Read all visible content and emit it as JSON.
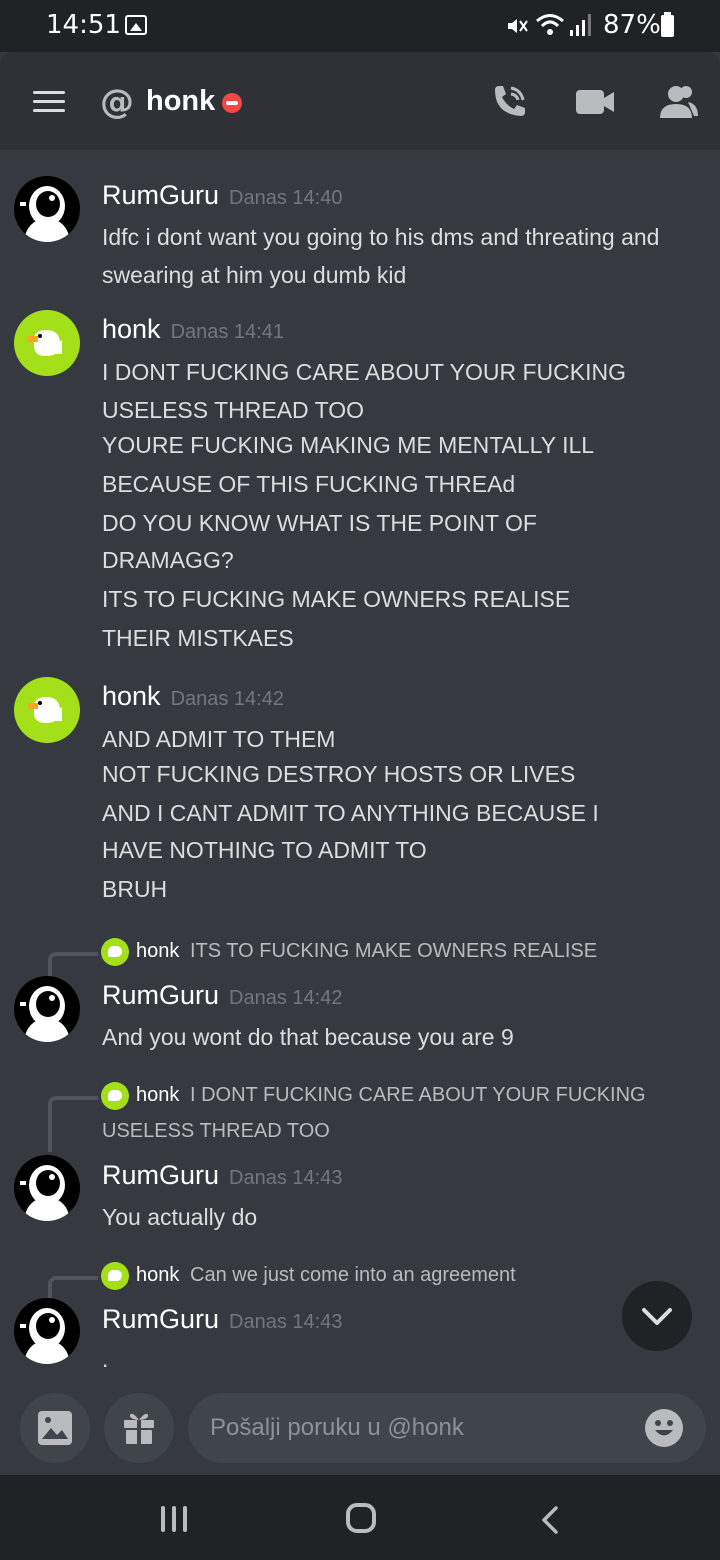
{
  "status_bar": {
    "time": "14:51",
    "battery": "87%",
    "icons": [
      "image-icon",
      "mute-icon",
      "wifi-icon",
      "signal-icon",
      "battery-icon"
    ]
  },
  "header": {
    "prefix": "@",
    "title": "honk",
    "status": "do-not-disturb",
    "status_color": "#f04747"
  },
  "messages": [
    {
      "author": "RumGuru",
      "timestamp": "Danas 14:40",
      "avatar": "astronaut-avatar",
      "lines": [
        "Idfc i dont want you going to his dms and threating and",
        "swearing at him you dumb kid"
      ]
    },
    {
      "author": "honk",
      "timestamp": "Danas 14:41",
      "avatar": "duck-avatar",
      "lines": [
        "I DONT FUCKING CARE ABOUT YOUR FUCKING",
        "USELESS THREAD TOO",
        "YOURE FUCKING MAKING ME MENTALLY ILL",
        "BECAUSE OF THIS FUCKING THREAd",
        "DO YOU KNOW WHAT IS THE POINT OF",
        "DRAMAGG?",
        "ITS TO FUCKING MAKE OWNERS REALISE",
        "THEIR MISTKAES"
      ]
    },
    {
      "author": "honk",
      "timestamp": "Danas 14:42",
      "avatar": "duck-avatar",
      "lines": [
        "AND ADMIT TO THEM",
        "NOT FUCKING DESTROY HOSTS OR LIVES",
        "AND I CANT ADMIT TO ANYTHING BECAUSE I",
        "HAVE NOTHING TO ADMIT TO",
        "BRUH"
      ]
    },
    {
      "reply_to": {
        "author": "honk",
        "lines": [
          "ITS TO FUCKING MAKE OWNERS REALISE"
        ]
      },
      "author": "RumGuru",
      "timestamp": "Danas 14:42",
      "avatar": "astronaut-avatar",
      "lines": [
        "And you wont do that because you are 9"
      ]
    },
    {
      "reply_to": {
        "author": "honk",
        "lines": [
          "I DONT FUCKING CARE ABOUT YOUR FUCKING",
          "USELESS THREAD TOO"
        ]
      },
      "author": "RumGuru",
      "timestamp": "Danas 14:43",
      "avatar": "astronaut-avatar",
      "lines": [
        "You actually do"
      ]
    },
    {
      "reply_to": {
        "author": "honk",
        "lines": [
          "Can we just come into an agreement"
        ]
      },
      "author": "RumGuru",
      "timestamp": "Danas 14:43",
      "avatar": "astronaut-avatar",
      "lines": [
        "."
      ]
    }
  ],
  "input": {
    "placeholder": "Pošalji poruku u @honk",
    "value": ""
  },
  "colors": {
    "background": "#36393f",
    "header": "#2f3136",
    "input": "#40444b",
    "honk_avatar": "#a4e019",
    "timestamp": "#72767d"
  }
}
